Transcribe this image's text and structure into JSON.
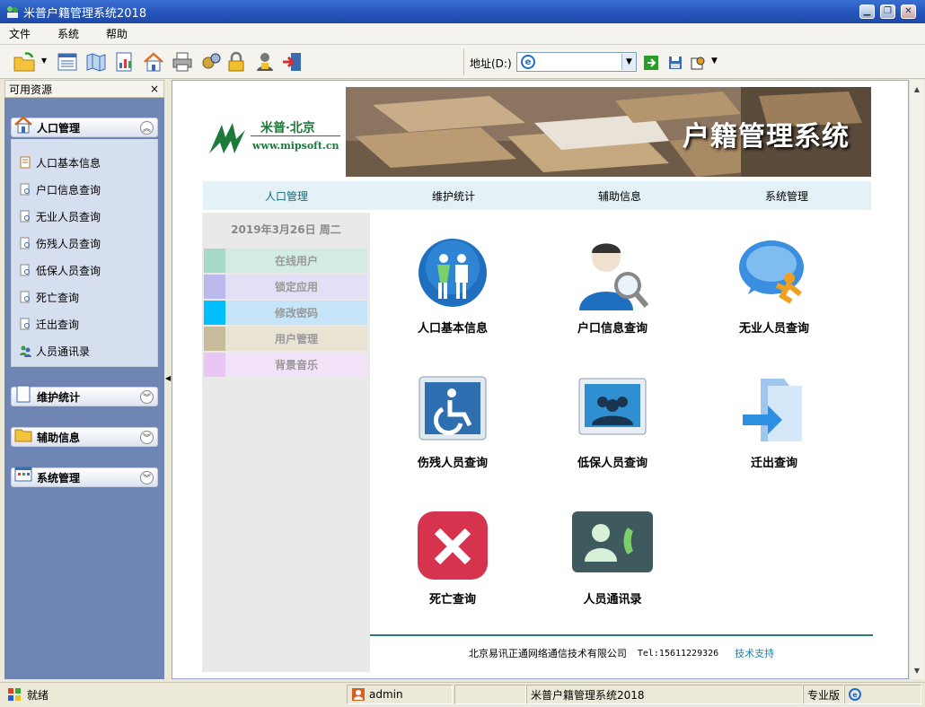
{
  "window": {
    "title": "米普户籍管理系统2018"
  },
  "menu": {
    "items": [
      "文件",
      "系统",
      "帮助"
    ]
  },
  "toolbar": {
    "address_label": "地址(D:)"
  },
  "sidebar": {
    "header": "可用资源",
    "close": "×",
    "groups": [
      {
        "label": "人口管理",
        "expanded": true,
        "items": [
          "人口基本信息",
          "户口信息查询",
          "无业人员查询",
          "伤残人员查询",
          "低保人员查询",
          "死亡查询",
          "迁出查询",
          "人员通讯录"
        ]
      },
      {
        "label": "维护统计",
        "expanded": false
      },
      {
        "label": "辅助信息",
        "expanded": false
      },
      {
        "label": "系统管理",
        "expanded": false
      }
    ]
  },
  "page": {
    "logo_name": "米普·北京",
    "logo_url": "www.mipsoft.cn",
    "banner_title": "户籍管理系统",
    "nav": [
      "人口管理",
      "维护统计",
      "辅助信息",
      "系统管理"
    ],
    "date": "2019年3月26日 周二",
    "left_menu": [
      {
        "label": "在线用户",
        "color": "#a7d9c6",
        "bg": "#d3ece2"
      },
      {
        "label": "锁定应用",
        "color": "#bdb8ec",
        "bg": "#e3e0f5"
      },
      {
        "label": "修改密码",
        "color": "#00bfff",
        "bg": "#c6e5f8"
      },
      {
        "label": "用户管理",
        "color": "#c8bb9a",
        "bg": "#e9e3d3"
      },
      {
        "label": "背景音乐",
        "color": "#e9c6f3",
        "bg": "#f3e3f8"
      }
    ],
    "tiles": [
      "人口基本信息",
      "户口信息查询",
      "无业人员查询",
      "伤残人员查询",
      "低保人员查询",
      "迁出查询",
      "死亡查询",
      "人员通讯录"
    ],
    "footer": {
      "company": "北京易讯正通网络通信技术有限公司",
      "tel": "Tel:15611229326",
      "support": "技术支持"
    }
  },
  "status": {
    "ready": "就绪",
    "user": "admin",
    "app": "米普户籍管理系统2018",
    "edition": "专业版"
  }
}
